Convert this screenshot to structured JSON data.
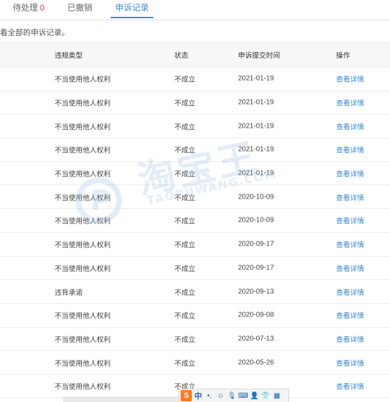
{
  "tabs": [
    {
      "label": "待处理",
      "count": "0",
      "active": false
    },
    {
      "label": "已撤销",
      "active": false
    },
    {
      "label": "申诉记录",
      "active": true
    }
  ],
  "hint": "看全部的申诉记录。",
  "table": {
    "headers": {
      "type": "违规类型",
      "status": "状态",
      "time": "申诉提交时间",
      "op": "操作"
    },
    "rows": [
      {
        "type": "不当使用他人权利",
        "status": "不成立",
        "time": "2021-01-19",
        "op": "查看详情"
      },
      {
        "type": "不当使用他人权利",
        "status": "不成立",
        "time": "2021-01-19",
        "op": "查看详情"
      },
      {
        "type": "不当使用他人权利",
        "status": "不成立",
        "time": "2021-01-19",
        "op": "查看详情"
      },
      {
        "type": "不当使用他人权利",
        "status": "不成立",
        "time": "2021-01-19",
        "op": "查看详情"
      },
      {
        "type": "不当使用他人权利",
        "status": "不成立",
        "time": "2021-01-19",
        "op": "查看详情"
      },
      {
        "type": "不当使用他人权利",
        "status": "不成立",
        "time": "2020-10-09",
        "op": "查看详情"
      },
      {
        "type": "不当使用他人权利",
        "status": "不成立",
        "time": "2020-10-09",
        "op": "查看详情"
      },
      {
        "type": "不当使用他人权利",
        "status": "不成立",
        "time": "2020-09-17",
        "op": "查看详情"
      },
      {
        "type": "不当使用他人权利",
        "status": "不成立",
        "time": "2020-09-17",
        "op": "查看详情"
      },
      {
        "type": "违背承诺",
        "status": "不成立",
        "time": "2020-09-13",
        "op": "查看详情"
      },
      {
        "type": "不当使用他人权利",
        "status": "不成立",
        "time": "2020-09-08",
        "op": "查看详情"
      },
      {
        "type": "不当使用他人权利",
        "status": "不成立",
        "time": "2020-07-13",
        "op": "查看详情"
      },
      {
        "type": "不当使用他人权利",
        "status": "不成立",
        "time": "2020-05-26",
        "op": "查看详情"
      },
      {
        "type": "不当使用他人权利",
        "status": "不成立",
        "time": "",
        "op": "查看详情"
      }
    ]
  },
  "watermark": {
    "cn": "淘宝王",
    "en": "TAOPUWANG.COM"
  },
  "ime_toolbar": {
    "logo": "S",
    "lang": "中",
    "icons": [
      "punctuation-icon",
      "emoji-icon",
      "microphone-icon",
      "keyboard-icon",
      "user-icon",
      "skin-icon",
      "apps-icon"
    ]
  },
  "colors": {
    "accent": "#3b8ad9",
    "badge": "#e4393c",
    "header_bg": "#f7f7f7"
  }
}
